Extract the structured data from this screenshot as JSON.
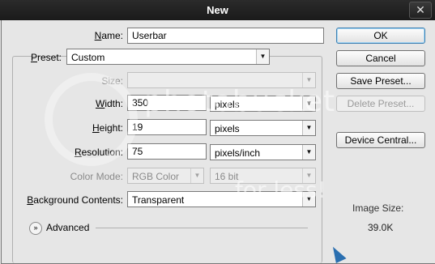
{
  "window": {
    "title": "New",
    "close_glyph": "✕"
  },
  "form": {
    "name": {
      "label_underline": "N",
      "label_rest": "ame:",
      "value": "Userbar"
    },
    "preset": {
      "label_underline": "P",
      "label_rest": "reset:",
      "value": "Custom"
    },
    "size": {
      "label": "Size:",
      "value": ""
    },
    "width": {
      "label_underline": "W",
      "label_rest": "idth:",
      "value": "350",
      "unit": "pixels"
    },
    "height": {
      "label_underline": "H",
      "label_rest": "eight:",
      "value": "19",
      "unit": "pixels"
    },
    "resolution": {
      "label_underline": "R",
      "label_rest": "esolution:",
      "value": "75",
      "unit": "pixels/inch"
    },
    "color_mode": {
      "label": "Color Mode:",
      "value": "RGB Color",
      "depth": "16 bit"
    },
    "background": {
      "label_underline": "B",
      "label_rest": "ackground Contents:",
      "value": "Transparent"
    },
    "advanced": {
      "label": "Advanced",
      "toggle_glyph": "»"
    }
  },
  "buttons": {
    "ok": "OK",
    "cancel": "Cancel",
    "save_preset": "Save Preset...",
    "delete_preset": "Delete Preset...",
    "device_central": "Device Central..."
  },
  "image_size": {
    "label": "Image Size:",
    "value": "39.0K"
  },
  "watermark": {
    "line1": "photobucket",
    "line2": "for less!"
  },
  "icons": {
    "dropdown": "chevron-down-icon",
    "close": "close-icon",
    "advanced_toggle": "double-chevron-icon"
  }
}
